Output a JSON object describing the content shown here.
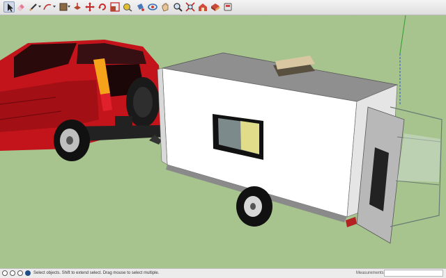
{
  "toolbar": {
    "tools": [
      {
        "icon": "select-arrow-icon",
        "active": true
      },
      {
        "icon": "eraser-icon"
      },
      {
        "icon": "line-pencil-icon"
      },
      {
        "icon": "arc-icon"
      },
      {
        "icon": "rectangle-icon"
      },
      {
        "icon": "push-pull-icon"
      },
      {
        "icon": "move-icon"
      },
      {
        "icon": "rotate-icon"
      },
      {
        "icon": "scale-icon"
      },
      {
        "icon": "tape-measure-icon"
      },
      {
        "icon": "paint-bucket-icon"
      },
      {
        "icon": "orbit-icon"
      },
      {
        "icon": "pan-icon"
      },
      {
        "icon": "zoom-icon"
      },
      {
        "icon": "zoom-extents-icon"
      },
      {
        "icon": "warehouse-icon"
      },
      {
        "icon": "extension-warehouse-icon"
      },
      {
        "icon": "layout-icon"
      }
    ]
  },
  "colors": {
    "sky": "#ffffff",
    "ground": "#a7c48f",
    "car_body": "#c3141b",
    "trailer_wall": "#ffffff",
    "trailer_roof": "#8f8f8f",
    "tail_light": "#f5a31a"
  },
  "status": {
    "message": "Select objects. Shift to extend select. Drag mouse to select multiple.",
    "measurements_label": "Measurements",
    "measurements_value": ""
  }
}
